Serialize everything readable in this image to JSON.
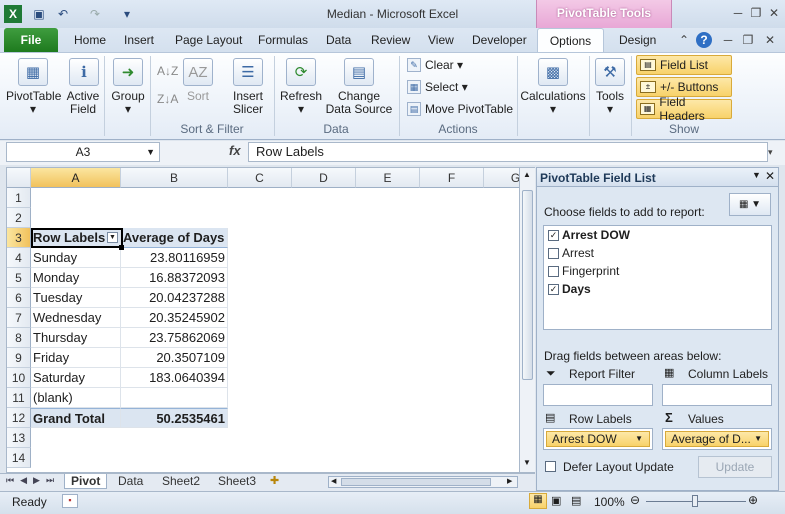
{
  "window": {
    "title": "Median  -  Microsoft Excel",
    "context_tab_group": "PivotTable Tools"
  },
  "tabs": [
    "File",
    "Home",
    "Insert",
    "Page Layout",
    "Formulas",
    "Data",
    "Review",
    "View",
    "Developer",
    "Options",
    "Design"
  ],
  "ribbon": {
    "pivottable": "PivotTable",
    "active_field": "Active Field",
    "group": "Group",
    "sort": "Sort",
    "insert_slicer": "Insert Slicer",
    "refresh": "Refresh",
    "change_data_source": "Change Data Source",
    "clear": "Clear",
    "select": "Select",
    "move_pivottable": "Move PivotTable",
    "calculations": "Calculations",
    "tools": "Tools",
    "field_list": "Field List",
    "buttons": "+/- Buttons",
    "field_headers": "Field Headers",
    "groups": {
      "sort_filter": "Sort & Filter",
      "data": "Data",
      "actions": "Actions",
      "show": "Show"
    }
  },
  "formula_bar": {
    "name_box": "A3",
    "fx": "fx",
    "formula": "Row Labels"
  },
  "grid": {
    "columns": [
      "A",
      "B",
      "C",
      "D",
      "E",
      "F",
      "G"
    ],
    "rows": [
      "1",
      "2",
      "3",
      "4",
      "5",
      "6",
      "7",
      "8",
      "9",
      "10",
      "11",
      "12",
      "13",
      "14"
    ],
    "header": {
      "a": "Row Labels",
      "b": "Average of Days"
    },
    "data": [
      {
        "label": "Sunday",
        "value": "23.80116959"
      },
      {
        "label": "Monday",
        "value": "16.88372093"
      },
      {
        "label": "Tuesday",
        "value": "20.04237288"
      },
      {
        "label": "Wednesday",
        "value": "20.35245902"
      },
      {
        "label": "Thursday",
        "value": "23.75862069"
      },
      {
        "label": "Friday",
        "value": "20.3507109"
      },
      {
        "label": "Saturday",
        "value": "183.0640394"
      },
      {
        "label": "(blank)",
        "value": ""
      }
    ],
    "total": {
      "label": "Grand Total",
      "value": "50.2535461"
    }
  },
  "sheets": [
    "Pivot",
    "Data",
    "Sheet2",
    "Sheet3"
  ],
  "status": {
    "ready": "Ready",
    "zoom": "100%"
  },
  "field_list": {
    "title": "PivotTable Field List",
    "choose_label": "Choose fields to add to report:",
    "fields": [
      {
        "name": "Arrest DOW",
        "checked": true
      },
      {
        "name": "Arrest",
        "checked": false
      },
      {
        "name": "Fingerprint",
        "checked": false
      },
      {
        "name": "Days",
        "checked": true
      }
    ],
    "drag_label": "Drag fields between areas below:",
    "report_filter": "Report Filter",
    "column_labels": "Column Labels",
    "row_labels": "Row Labels",
    "values": "Values",
    "row_field": "Arrest DOW",
    "value_field": "Average of D...",
    "defer_label": "Defer Layout Update",
    "update_button": "Update"
  }
}
